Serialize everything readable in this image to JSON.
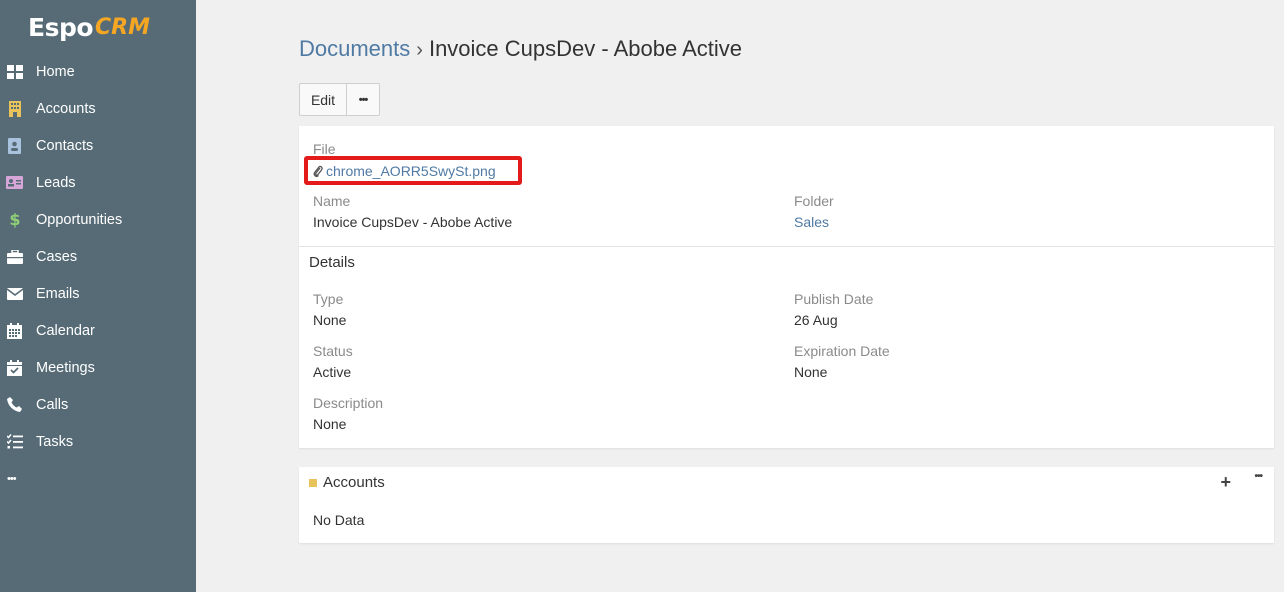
{
  "app": {
    "logo_text": "Espo",
    "logo_crm": "CRM"
  },
  "sidebar": {
    "items": [
      {
        "label": "Home",
        "icon": "grid-icon",
        "color": "#ffffff"
      },
      {
        "label": "Accounts",
        "icon": "building-icon",
        "color": "#e8c35a"
      },
      {
        "label": "Contacts",
        "icon": "contact-card-icon",
        "color": "#a9c2de"
      },
      {
        "label": "Leads",
        "icon": "id-card-icon",
        "color": "#d6a6d8"
      },
      {
        "label": "Opportunities",
        "icon": "dollar-icon",
        "color": "#8fcf77"
      },
      {
        "label": "Cases",
        "icon": "briefcase-icon",
        "color": "#ffffff"
      },
      {
        "label": "Emails",
        "icon": "envelope-icon",
        "color": "#ffffff"
      },
      {
        "label": "Calendar",
        "icon": "calendar-icon",
        "color": "#ffffff"
      },
      {
        "label": "Meetings",
        "icon": "calendar-check-icon",
        "color": "#ffffff"
      },
      {
        "label": "Calls",
        "icon": "phone-icon",
        "color": "#ffffff"
      },
      {
        "label": "Tasks",
        "icon": "tasks-icon",
        "color": "#ffffff"
      }
    ],
    "more": "•••"
  },
  "breadcrumb": {
    "parent": "Documents",
    "separator": "›",
    "current": "Invoice CupsDev - Abobe Active"
  },
  "toolbar": {
    "edit_label": "Edit",
    "more_label": "•••"
  },
  "record": {
    "file_label": "File",
    "file_value": "chrome_AORR5SwySt.png",
    "name_label": "Name",
    "name_value": "Invoice CupsDev - Abobe Active",
    "folder_label": "Folder",
    "folder_value": "Sales"
  },
  "details": {
    "title": "Details",
    "type_label": "Type",
    "type_value": "None",
    "publish_label": "Publish Date",
    "publish_value": "26 Aug",
    "status_label": "Status",
    "status_value": "Active",
    "expiration_label": "Expiration Date",
    "expiration_value": "None",
    "description_label": "Description",
    "description_value": "None"
  },
  "accounts_panel": {
    "title": "Accounts",
    "add_label": "+",
    "more_label": "•••",
    "empty_text": "No Data"
  },
  "colors": {
    "sidebar_bg": "#566b76",
    "link": "#4f7aa3",
    "highlight_border": "#e31b1b",
    "accounts_accent": "#e8c35a"
  }
}
